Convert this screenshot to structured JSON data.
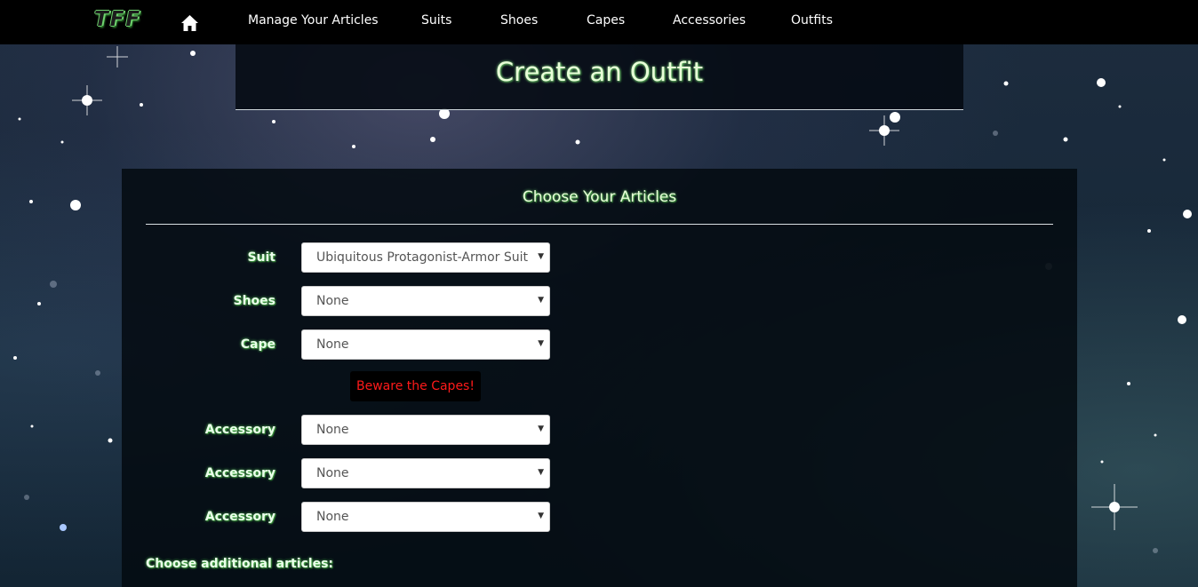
{
  "nav": {
    "brand": "TFF",
    "home_icon": "home-icon",
    "links": [
      "Manage Your Articles",
      "Suits",
      "Shoes",
      "Capes",
      "Accessories",
      "Outfits"
    ]
  },
  "header": {
    "title": "Create an Outfit"
  },
  "form": {
    "section_title": "Choose Your Articles",
    "fields": [
      {
        "label": "Suit",
        "value": "Ubiquitous Protagonist-Armor Suit"
      },
      {
        "label": "Shoes",
        "value": "None"
      },
      {
        "label": "Cape",
        "value": "None"
      },
      {
        "label": "Accessory",
        "value": "None"
      },
      {
        "label": "Accessory",
        "value": "None"
      },
      {
        "label": "Accessory",
        "value": "None"
      }
    ],
    "warning_button": "Beware the Capes!",
    "additional_label": "Choose additional articles:"
  },
  "colors": {
    "navbar": "#000000",
    "title_glow": "#8be08b",
    "warning_text": "#ff1a1a"
  }
}
